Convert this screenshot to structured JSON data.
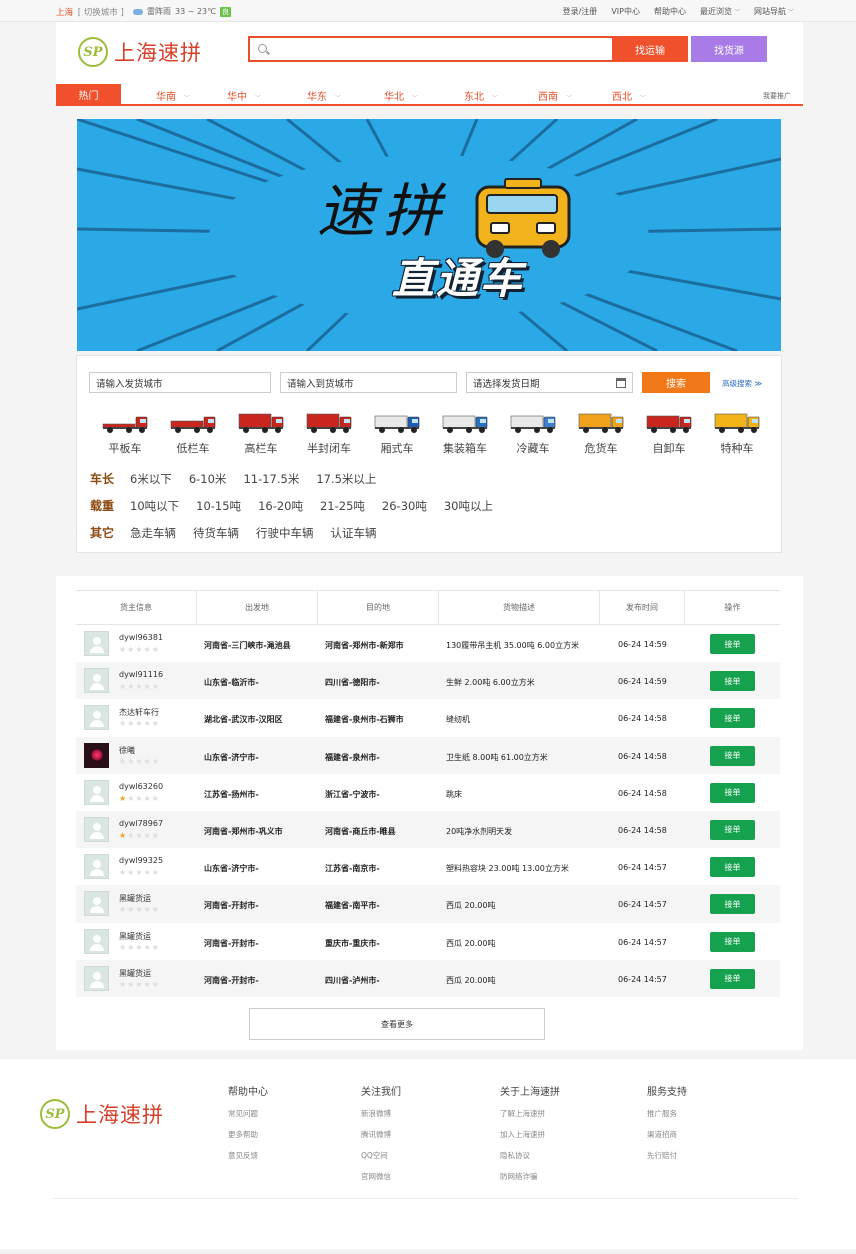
{
  "topbar": {
    "city": "上海",
    "switch_city": "[ 切换城市 ]",
    "weather": "雷阵雨",
    "temp": "33 ~ 23℃",
    "aqi": "良",
    "links": [
      "登录/注册",
      "VIP中心",
      "帮助中心",
      "最近浏览",
      "网站导航"
    ]
  },
  "header": {
    "logo_mark": "SP",
    "logo_text": "上海速拼",
    "search_placeholder": "",
    "btn_transport": "找运输",
    "btn_cargo": "找货源"
  },
  "nav": {
    "hot": "热门",
    "regions": [
      "华南",
      "华中",
      "华东",
      "华北",
      "东北",
      "西南",
      "西北"
    ],
    "promo": "我要推广"
  },
  "banner": {
    "title_top": "速拼",
    "title_bottom": "直通车"
  },
  "filter": {
    "from_placeholder": "请输入发货城市",
    "to_placeholder": "请输入到货城市",
    "date_placeholder": "请选择发货日期",
    "search_btn": "搜索",
    "advanced": "高级搜索 ≫",
    "trucks": [
      {
        "label": "平板车",
        "color": "#c8261e",
        "box": "flat"
      },
      {
        "label": "低栏车",
        "color": "#c8261e",
        "box": "low"
      },
      {
        "label": "高栏车",
        "color": "#c8261e",
        "box": "high"
      },
      {
        "label": "半封闭车",
        "color": "#c8261e",
        "box": "semi"
      },
      {
        "label": "厢式车",
        "color": "#1d5fb4",
        "box": "van"
      },
      {
        "label": "集装箱车",
        "color": "#2a6fc0",
        "box": "container"
      },
      {
        "label": "冷藏车",
        "color": "#3c7fd0",
        "box": "cold"
      },
      {
        "label": "危货车",
        "color": "#f0a21c",
        "box": "danger"
      },
      {
        "label": "自卸车",
        "color": "#c8261e",
        "box": "dump"
      },
      {
        "label": "特种车",
        "color": "#f0b418",
        "box": "special"
      }
    ],
    "length": {
      "key": "车长",
      "values": [
        "6米以下",
        "6-10米",
        "11-17.5米",
        "17.5米以上"
      ]
    },
    "weight": {
      "key": "载重",
      "values": [
        "10吨以下",
        "10-15吨",
        "16-20吨",
        "21-25吨",
        "26-30吨",
        "30吨以上"
      ]
    },
    "other": {
      "key": "其它",
      "values": [
        "急走车辆",
        "待货车辆",
        "行驶中车辆",
        "认证车辆"
      ]
    }
  },
  "table": {
    "headers": [
      "货主信息",
      "出发地",
      "目的地",
      "货物描述",
      "发布时间",
      "操作"
    ],
    "rows": [
      {
        "user": "dywl96381",
        "stars": 0,
        "photo": false,
        "from": "河南省-三门峡市-渑池县",
        "to": "河南省-郑州市-新郑市",
        "desc": "130履带吊主机  35.00吨  6.00立方米",
        "time": "06-24 14:59",
        "action": "接单"
      },
      {
        "user": "dywl91116",
        "stars": 0,
        "photo": false,
        "from": "山东省-临沂市-",
        "to": "四川省-德阳市-",
        "desc": "生鲜  2.00吨  6.00立方米",
        "time": "06-24 14:59",
        "action": "接单"
      },
      {
        "user": "杰达轩车行",
        "stars": 0,
        "photo": false,
        "from": "湖北省-武汉市-汉阳区",
        "to": "福建省-泉州市-石狮市",
        "desc": "缝纫机",
        "time": "06-24 14:58",
        "action": "接单"
      },
      {
        "user": "徐曦",
        "stars": 0,
        "photo": true,
        "from": "山东省-济宁市-",
        "to": "福建省-泉州市-",
        "desc": "卫生纸  8.00吨  61.00立方米",
        "time": "06-24 14:58",
        "action": "接单"
      },
      {
        "user": "dywl63260",
        "stars": 1,
        "photo": false,
        "from": "江苏省-扬州市-",
        "to": "浙江省-宁波市-",
        "desc": "跳床",
        "time": "06-24 14:58",
        "action": "接单"
      },
      {
        "user": "dywl78967",
        "stars": 1,
        "photo": false,
        "from": "河南省-郑州市-巩义市",
        "to": "河南省-商丘市-睢县",
        "desc": "20吨净水剂明天发",
        "time": "06-24 14:58",
        "action": "接单"
      },
      {
        "user": "dywl99325",
        "stars": 0,
        "photo": false,
        "from": "山东省-济宁市-",
        "to": "江苏省-南京市-",
        "desc": "塑料热容块  23.00吨  13.00立方米",
        "time": "06-24 14:57",
        "action": "接单"
      },
      {
        "user": "黑罐货运",
        "stars": 0,
        "photo": false,
        "from": "河南省-开封市-",
        "to": "福建省-南平市-",
        "desc": "西瓜  20.00吨",
        "time": "06-24 14:57",
        "action": "接单"
      },
      {
        "user": "黑罐货运",
        "stars": 0,
        "photo": false,
        "from": "河南省-开封市-",
        "to": "重庆市-重庆市-",
        "desc": "西瓜  20.00吨",
        "time": "06-24 14:57",
        "action": "接单"
      },
      {
        "user": "黑罐货运",
        "stars": 0,
        "photo": false,
        "from": "河南省-开封市-",
        "to": "四川省-泸州市-",
        "desc": "西瓜  20.00吨",
        "time": "06-24 14:57",
        "action": "接单"
      }
    ],
    "more": "查看更多"
  },
  "footer": {
    "logo_mark": "SP",
    "logo_text": "上海速拼",
    "columns": [
      {
        "title": "帮助中心",
        "links": [
          "常见问题",
          "更多帮助",
          "意见反馈"
        ]
      },
      {
        "title": "关注我们",
        "links": [
          "新浪微博",
          "腾讯微博",
          "QQ空间",
          "官网微信"
        ]
      },
      {
        "title": "关于上海速拼",
        "links": [
          "了解上海速拼",
          "加入上海速拼",
          "隐私协议",
          "防网络诈骗"
        ]
      },
      {
        "title": "服务支持",
        "links": [
          "推广服务",
          "渠道招商",
          "先行赔付"
        ]
      }
    ]
  }
}
